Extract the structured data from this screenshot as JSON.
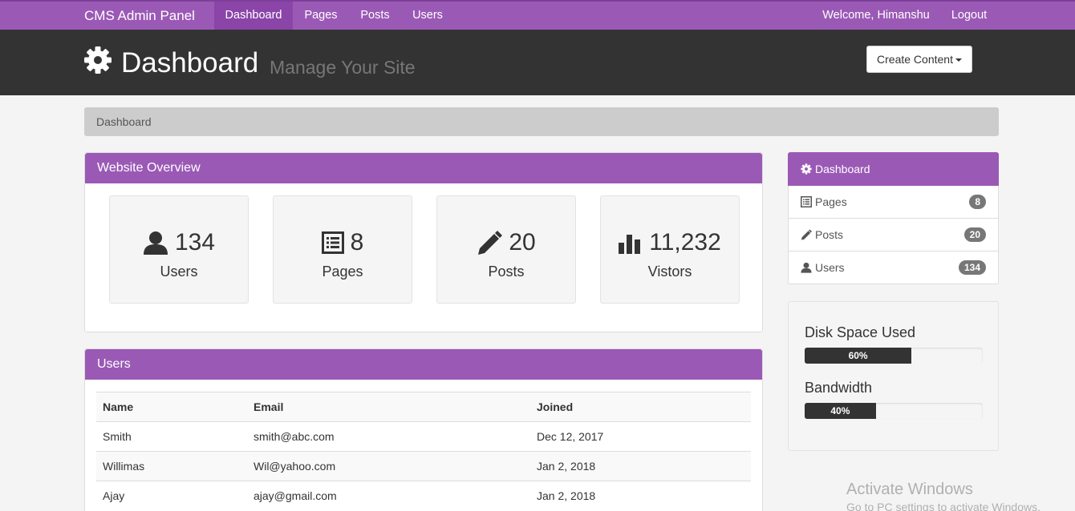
{
  "navbar": {
    "brand": "CMS Admin Panel",
    "items": [
      {
        "label": "Dashboard",
        "active": true
      },
      {
        "label": "Pages"
      },
      {
        "label": "Posts"
      },
      {
        "label": "Users"
      }
    ],
    "welcome": "Welcome, Himanshu",
    "logout": "Logout"
  },
  "header": {
    "title": "Dashboard",
    "subtitle": "Manage Your Site",
    "create_button": "Create Content",
    "icon": "gear-icon"
  },
  "breadcrumb": "Dashboard",
  "overview": {
    "title": "Website Overview",
    "stats": [
      {
        "icon": "user-icon",
        "value": "134",
        "label": "Users"
      },
      {
        "icon": "list-icon",
        "value": "8",
        "label": "Pages"
      },
      {
        "icon": "pencil-icon",
        "value": "20",
        "label": "Posts"
      },
      {
        "icon": "bar-chart-icon",
        "value": "11,232",
        "label": "Vistors"
      }
    ]
  },
  "users_panel": {
    "title": "Users",
    "columns": [
      "Name",
      "Email",
      "Joined"
    ],
    "rows": [
      [
        "Smith",
        "smith@abc.com",
        "Dec 12, 2017"
      ],
      [
        "Willimas",
        "Wil@yahoo.com",
        "Jan 2, 2018"
      ],
      [
        "Ajay",
        "ajay@gmail.com",
        "Jan 2, 2018"
      ]
    ]
  },
  "sidebar": {
    "items": [
      {
        "icon": "gear-icon",
        "label": "Dashboard",
        "active": true
      },
      {
        "icon": "list-icon",
        "label": "Pages",
        "badge": "8"
      },
      {
        "icon": "pencil-icon",
        "label": "Posts",
        "badge": "20"
      },
      {
        "icon": "user-icon",
        "label": "Users",
        "badge": "134"
      }
    ]
  },
  "usage": {
    "disk_label": "Disk Space Used",
    "disk_text": "60%",
    "disk_value": 0.6,
    "bandwidth_label": "Bandwidth",
    "bandwidth_text": "40%",
    "bandwidth_value": 0.4
  },
  "watermark": {
    "line1": "Activate Windows",
    "line2": "Go to PC settings to activate Windows."
  },
  "colors": {
    "accent": "#9b59b6",
    "header_bg": "#333333"
  }
}
